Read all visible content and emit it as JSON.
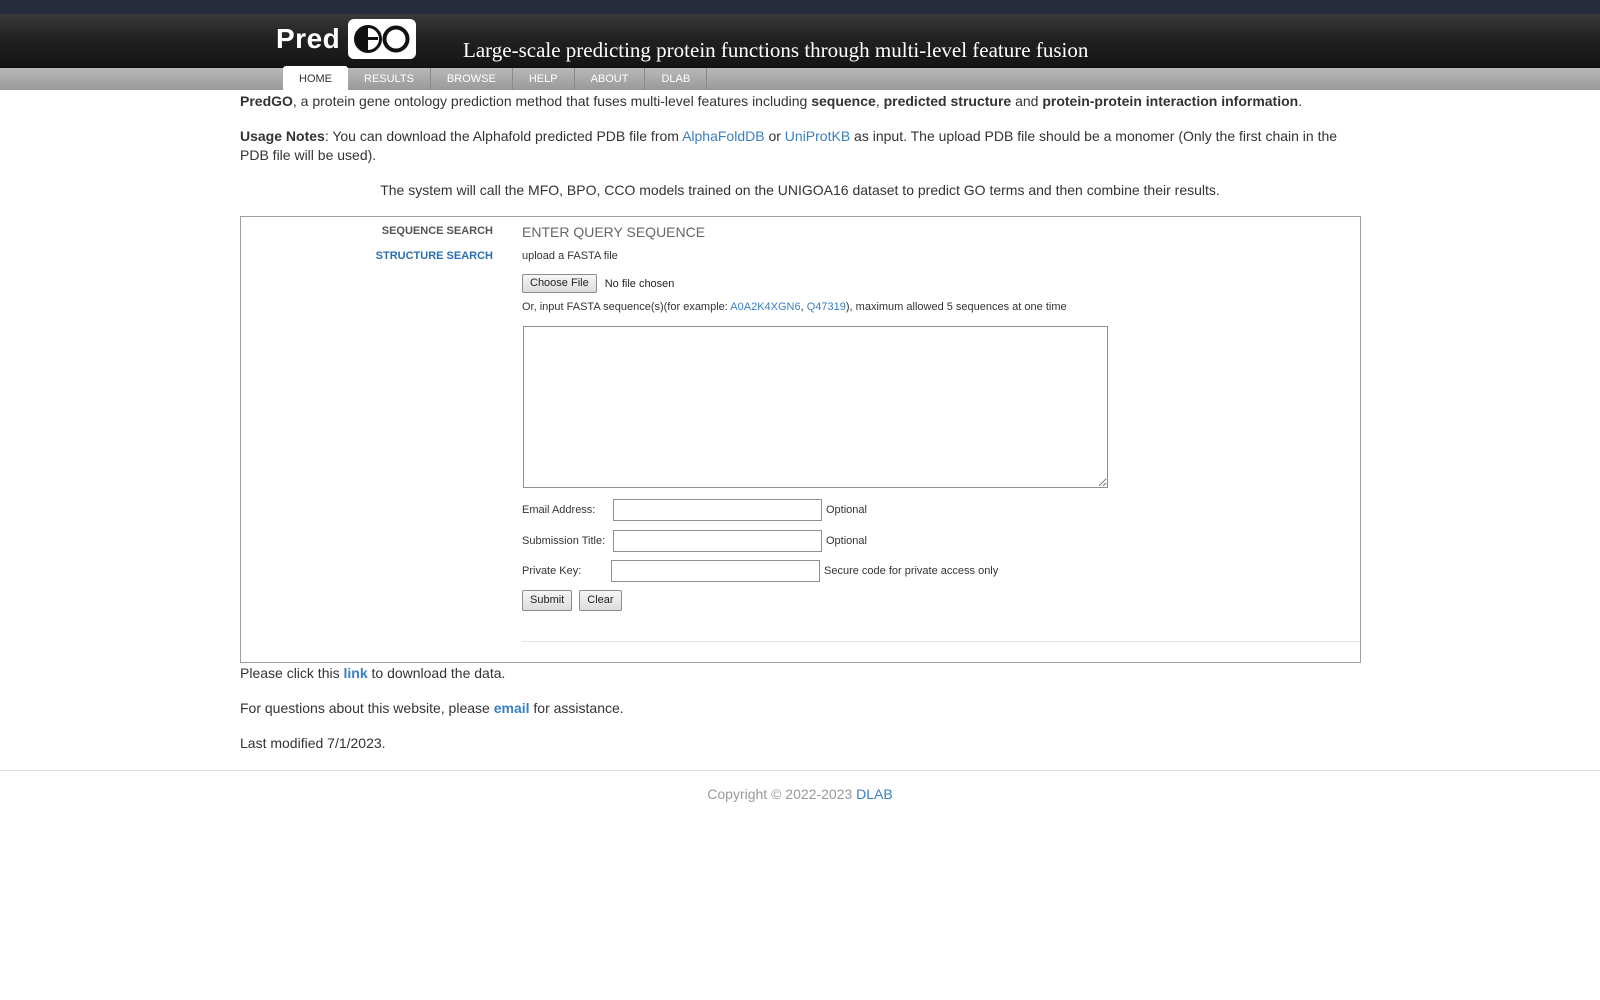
{
  "header": {
    "logo_text": "Pred",
    "logo_box_text": "GO",
    "title": "Large-scale predicting protein functions through multi-level feature fusion"
  },
  "nav": {
    "items": [
      {
        "label": "HOME"
      },
      {
        "label": "RESULTS"
      },
      {
        "label": "BROWSE"
      },
      {
        "label": "HELP"
      },
      {
        "label": "ABOUT"
      },
      {
        "label": "DLAB"
      }
    ],
    "active": "HOME"
  },
  "intro": {
    "name": "PredGO",
    "text1": ", a protein gene ontology prediction method that fuses multi-level features including ",
    "kw1": "sequence",
    "sep1": ", ",
    "kw2": "predicted structure",
    "sep2": " and ",
    "kw3": "protein-protein interaction information",
    "end": "."
  },
  "usage": {
    "label": "Usage Notes",
    "text1": ": You can download the Alphafold predicted PDB file from ",
    "link1": "AlphaFoldDB",
    "or": " or ",
    "link2": "UniProtKB",
    "text2": " as input. The upload PDB file should be a monomer (Only the first chain in the PDB file will be used)."
  },
  "system_note": "The system will call the MFO, BPO, CCO models trained on the UNIGOA16 dataset to predict GO terms and then combine their results.",
  "search": {
    "sidebar": {
      "sequence_search": "SEQUENCE SEARCH",
      "structure_search": "STRUCTURE SEARCH"
    },
    "panel_title": "ENTER QUERY SEQUENCE",
    "upload_label": "upload a FASTA file",
    "choose_file_label": "Choose File",
    "file_status": "No file chosen",
    "example_prefix": "Or, input FASTA sequence(s)(for example: ",
    "example1": "A0A2K4XGN6",
    "example_sep": ",",
    "example2": "Q47319",
    "example_suffix": "), maximum allowed 5 sequences at one time",
    "sequence_value": "",
    "email_label": "Email Address:",
    "email_value": "",
    "email_hint": "Optional",
    "title_label": "Submission Title:",
    "title_value": "",
    "title_hint": "Optional",
    "key_label": "Private Key:",
    "key_value": "",
    "key_hint": "Secure code for private access only",
    "submit_label": "Submit",
    "clear_label": "Clear"
  },
  "download": {
    "prefix": "Please click this ",
    "link": "link",
    "suffix": " to download the data."
  },
  "contact": {
    "prefix": "For questions about this website, please ",
    "link": "email",
    "suffix": " for assistance."
  },
  "last_modified": "Last modified 7/1/2023.",
  "copyright": {
    "text": "Copyright © 2022-2023 ",
    "link": "DLAB"
  }
}
